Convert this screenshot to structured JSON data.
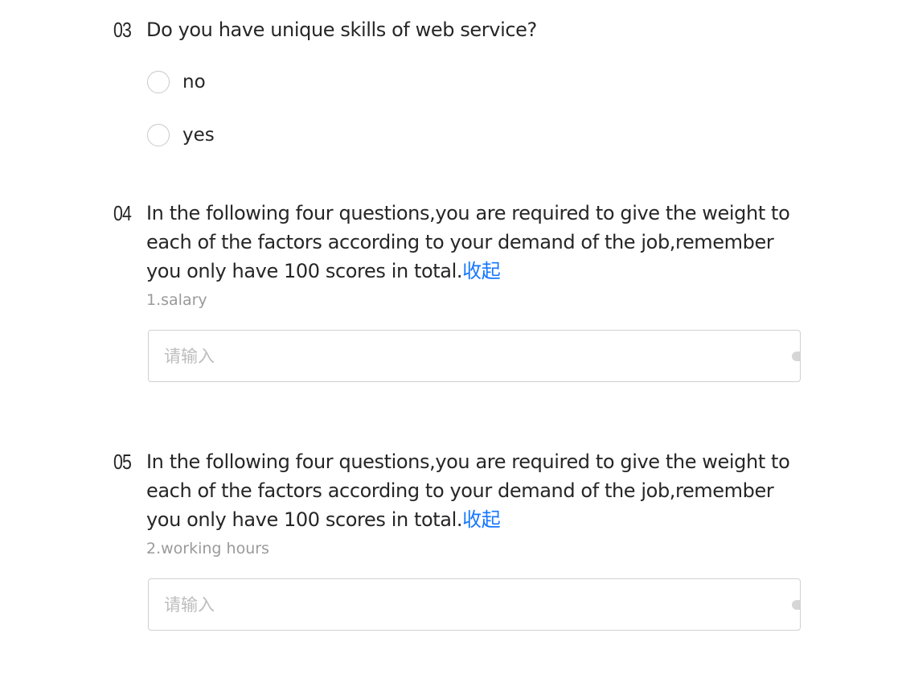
{
  "questions": [
    {
      "number": "03",
      "title": "Do you have unique skills of web service?",
      "options": [
        {
          "label": "no"
        },
        {
          "label": "yes"
        }
      ]
    },
    {
      "number": "04",
      "title": "In the following four questions,you are required to give the weight to each of the factors according to your demand of the job,remember you only have 100 scores in total.",
      "collapse_label": "收起",
      "sub_label": "1.salary",
      "input": {
        "value": "",
        "placeholder": "请输入"
      }
    },
    {
      "number": "05",
      "title": "In the following four questions,you are required to give the weight to each of the factors according to your demand of the job,remember you only have 100 scores in total.",
      "collapse_label": "收起",
      "sub_label": "2.working hours",
      "input": {
        "value": "",
        "placeholder": "请输入"
      }
    }
  ],
  "colors": {
    "link": "#1677ff",
    "text": "#262626",
    "muted": "#9a9a9a",
    "placeholder": "#bdbdbd",
    "border": "#d0d0d0"
  }
}
